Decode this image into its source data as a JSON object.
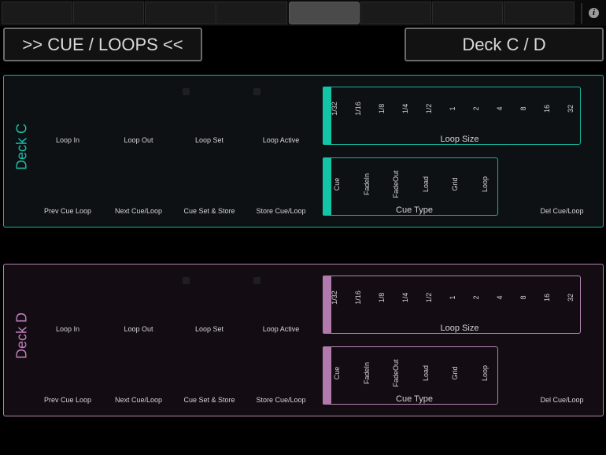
{
  "tabs": {
    "count": 8,
    "active_index": 4
  },
  "header": {
    "left_button": ">> CUE / LOOPS <<",
    "right_button": "Deck C / D"
  },
  "decks": [
    {
      "name": "Deck C",
      "row1": [
        "Loop In",
        "Loop Out",
        "Loop Set",
        "Loop Active"
      ],
      "row2": [
        "Prev Cue Loop",
        "Next Cue/Loop",
        "Cue Set & Store",
        "Store Cue/Loop"
      ],
      "loop_size": {
        "title": "Loop Size",
        "options": [
          "1/32",
          "1/16",
          "1/8",
          "1/4",
          "1/2",
          "1",
          "2",
          "4",
          "8",
          "16",
          "32"
        ],
        "selected": "1/32"
      },
      "cue_type": {
        "title": "Cue Type",
        "options": [
          "Cue",
          "FadeIn",
          "FadeOut",
          "Load",
          "Grid",
          "Loop"
        ],
        "selected": "Cue"
      },
      "del": "Del Cue/Loop"
    },
    {
      "name": "Deck D",
      "row1": [
        "Loop In",
        "Loop Out",
        "Loop Set",
        "Loop Active"
      ],
      "row2": [
        "Prev Cue Loop",
        "Next Cue/Loop",
        "Cue Set & Store",
        "Store Cue/Loop"
      ],
      "loop_size": {
        "title": "Loop Size",
        "options": [
          "1/32",
          "1/16",
          "1/8",
          "1/4",
          "1/2",
          "1",
          "2",
          "4",
          "8",
          "16",
          "32"
        ],
        "selected": "1/32"
      },
      "cue_type": {
        "title": "Cue Type",
        "options": [
          "Cue",
          "FadeIn",
          "FadeOut",
          "Load",
          "Grid",
          "Loop"
        ],
        "selected": "Cue"
      },
      "del": "Del Cue/Loop"
    }
  ],
  "colors": {
    "deck_c_accent": "#17b39a",
    "deck_d_accent": "#b584b1"
  },
  "icons": {
    "info": "info-icon"
  }
}
